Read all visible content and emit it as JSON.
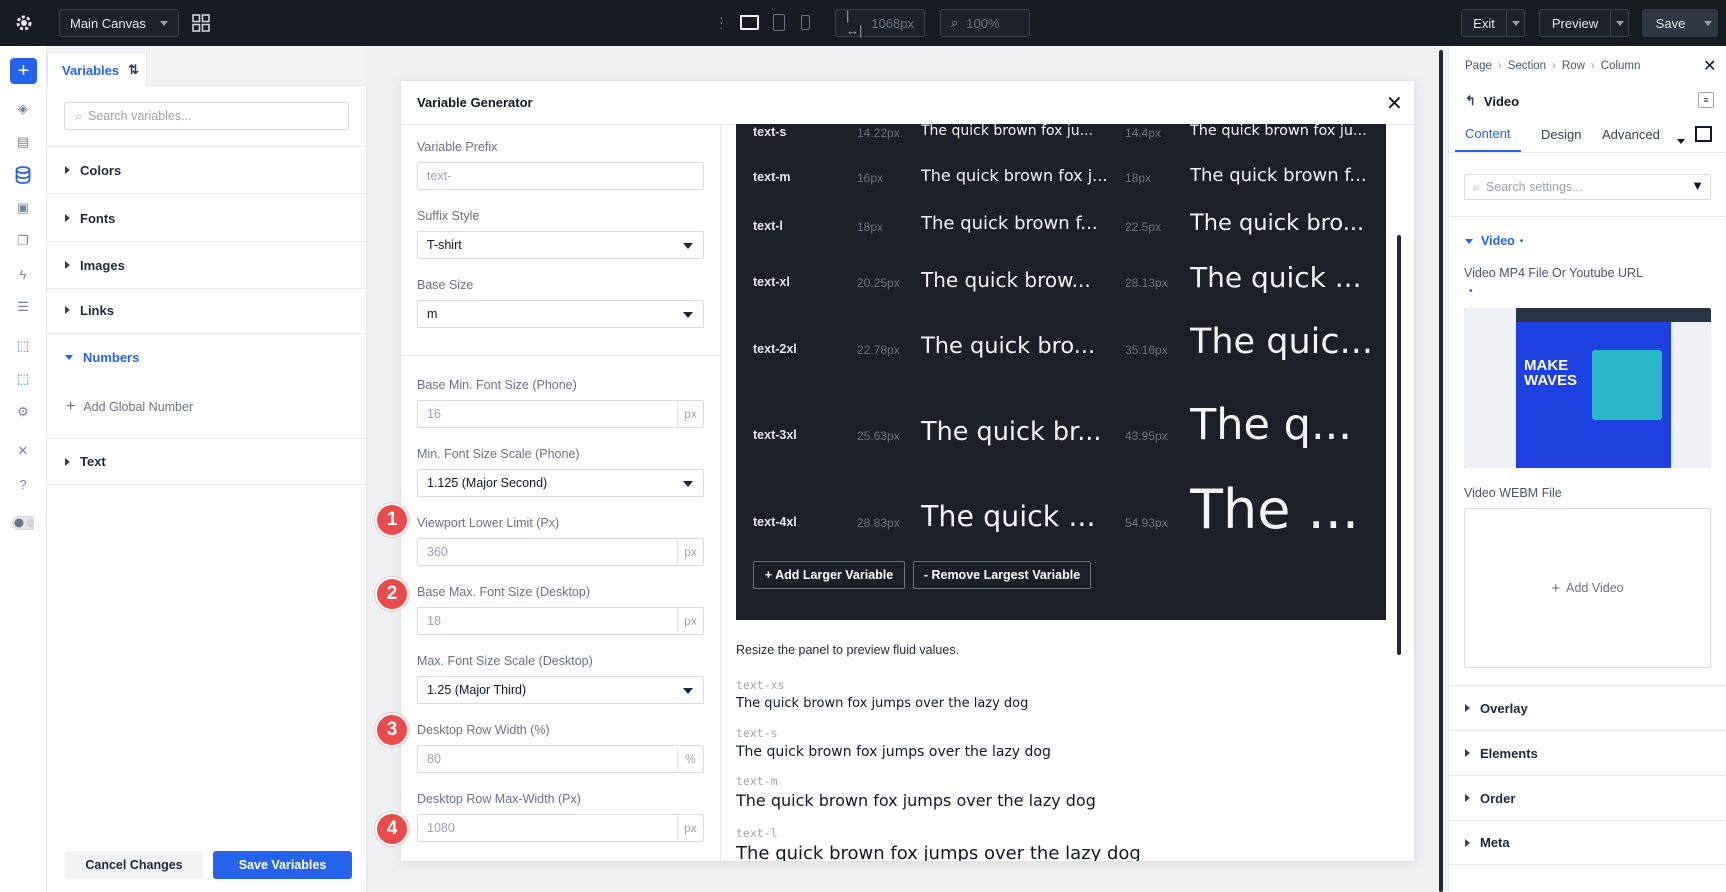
{
  "topbar": {
    "canvas_select": "Main Canvas",
    "width_value": "1068px",
    "zoom_value": "100%",
    "exit_label": "Exit",
    "preview_label": "Preview",
    "save_label": "Save"
  },
  "variables_panel": {
    "tab_label": "Variables",
    "search_placeholder": "Search variables...",
    "groups": [
      "Colors",
      "Fonts",
      "Images",
      "Links",
      "Numbers",
      "Text"
    ],
    "add_global_number": "Add Global Number",
    "cancel_label": "Cancel Changes",
    "save_label": "Save Variables"
  },
  "generator": {
    "title": "Variable Generator",
    "fields": {
      "prefix_label": "Variable Prefix",
      "prefix_placeholder": "text-",
      "suffix_label": "Suffix Style",
      "suffix_value": "T-shirt",
      "base_size_label": "Base Size",
      "base_size_value": "m",
      "min_font_label": "Base Min. Font Size (Phone)",
      "min_font_value": "16",
      "min_scale_label": "Min. Font Size Scale (Phone)",
      "min_scale_value": "1.125 (Major Second)",
      "viewport_label": "Viewport Lower Limit (Px)",
      "viewport_value": "360",
      "max_font_label": "Base Max. Font Size (Desktop)",
      "max_font_value": "18",
      "max_scale_label": "Max. Font Size Scale (Desktop)",
      "max_scale_value": "1.25 (Major Third)",
      "row_width_label": "Desktop Row Width (%)",
      "row_width_value": "80",
      "row_max_label": "Desktop Row Max-Width (Px)",
      "row_max_value": "1080",
      "unit_px": "px",
      "unit_pct": "%"
    },
    "callouts": [
      "1",
      "2",
      "3",
      "4"
    ],
    "preview_rows": [
      {
        "name": "text-s",
        "min": "14.22px",
        "max": "14.4px",
        "sample1": "The quick brown fox ju...",
        "sample2": "The quick brown fox ju..."
      },
      {
        "name": "text-m",
        "min": "16px",
        "max": "18px",
        "sample1": "The quick brown fox j...",
        "sample2": "The quick brown f..."
      },
      {
        "name": "text-l",
        "min": "18px",
        "max": "22.5px",
        "sample1": "The quick brown f...",
        "sample2": "The quick bro..."
      },
      {
        "name": "text-xl",
        "min": "20.25px",
        "max": "28.13px",
        "sample1": "The quick brow...",
        "sample2": "The quick ..."
      },
      {
        "name": "text-2xl",
        "min": "22.78px",
        "max": "35.16px",
        "sample1": "The quick bro...",
        "sample2": "The quic..."
      },
      {
        "name": "text-3xl",
        "min": "25.63px",
        "max": "43.95px",
        "sample1": "The quick br...",
        "sample2": "The q..."
      },
      {
        "name": "text-4xl",
        "min": "28.83px",
        "max": "54.93px",
        "sample1": "The quick ...",
        "sample2": "The ..."
      }
    ],
    "add_larger": "+ Add Larger Variable",
    "remove_largest": "- Remove Largest Variable",
    "resize_hint": "Resize the panel to preview fluid values.",
    "samples": [
      {
        "token": "text-xs",
        "text": "The quick brown fox jumps over the lazy dog"
      },
      {
        "token": "text-s",
        "text": "The quick brown fox jumps over the lazy dog"
      },
      {
        "token": "text-m",
        "text": "The quick brown fox jumps over the lazy dog"
      },
      {
        "token": "text-l",
        "text": "The quick brown fox jumps over the lazy dog"
      }
    ]
  },
  "settings": {
    "breadcrumb": [
      "Page",
      "Section",
      "Row",
      "Column"
    ],
    "module_title": "Video",
    "tabs": [
      "Content",
      "Design",
      "Advanced"
    ],
    "search_placeholder": "Search settings...",
    "video_group": "Video",
    "mp4_label": "Video MP4 File Or Youtube URL",
    "thumb_text": "MAKE WAVES",
    "webm_label": "Video WEBM File",
    "add_video": "Add Video",
    "groups": [
      "Overlay",
      "Elements",
      "Order",
      "Meta"
    ]
  },
  "colors": {
    "accent": "#2563eb",
    "topbar": "#161a22",
    "callout": "#e84b4b",
    "preview_bg": "#1b1f27"
  }
}
